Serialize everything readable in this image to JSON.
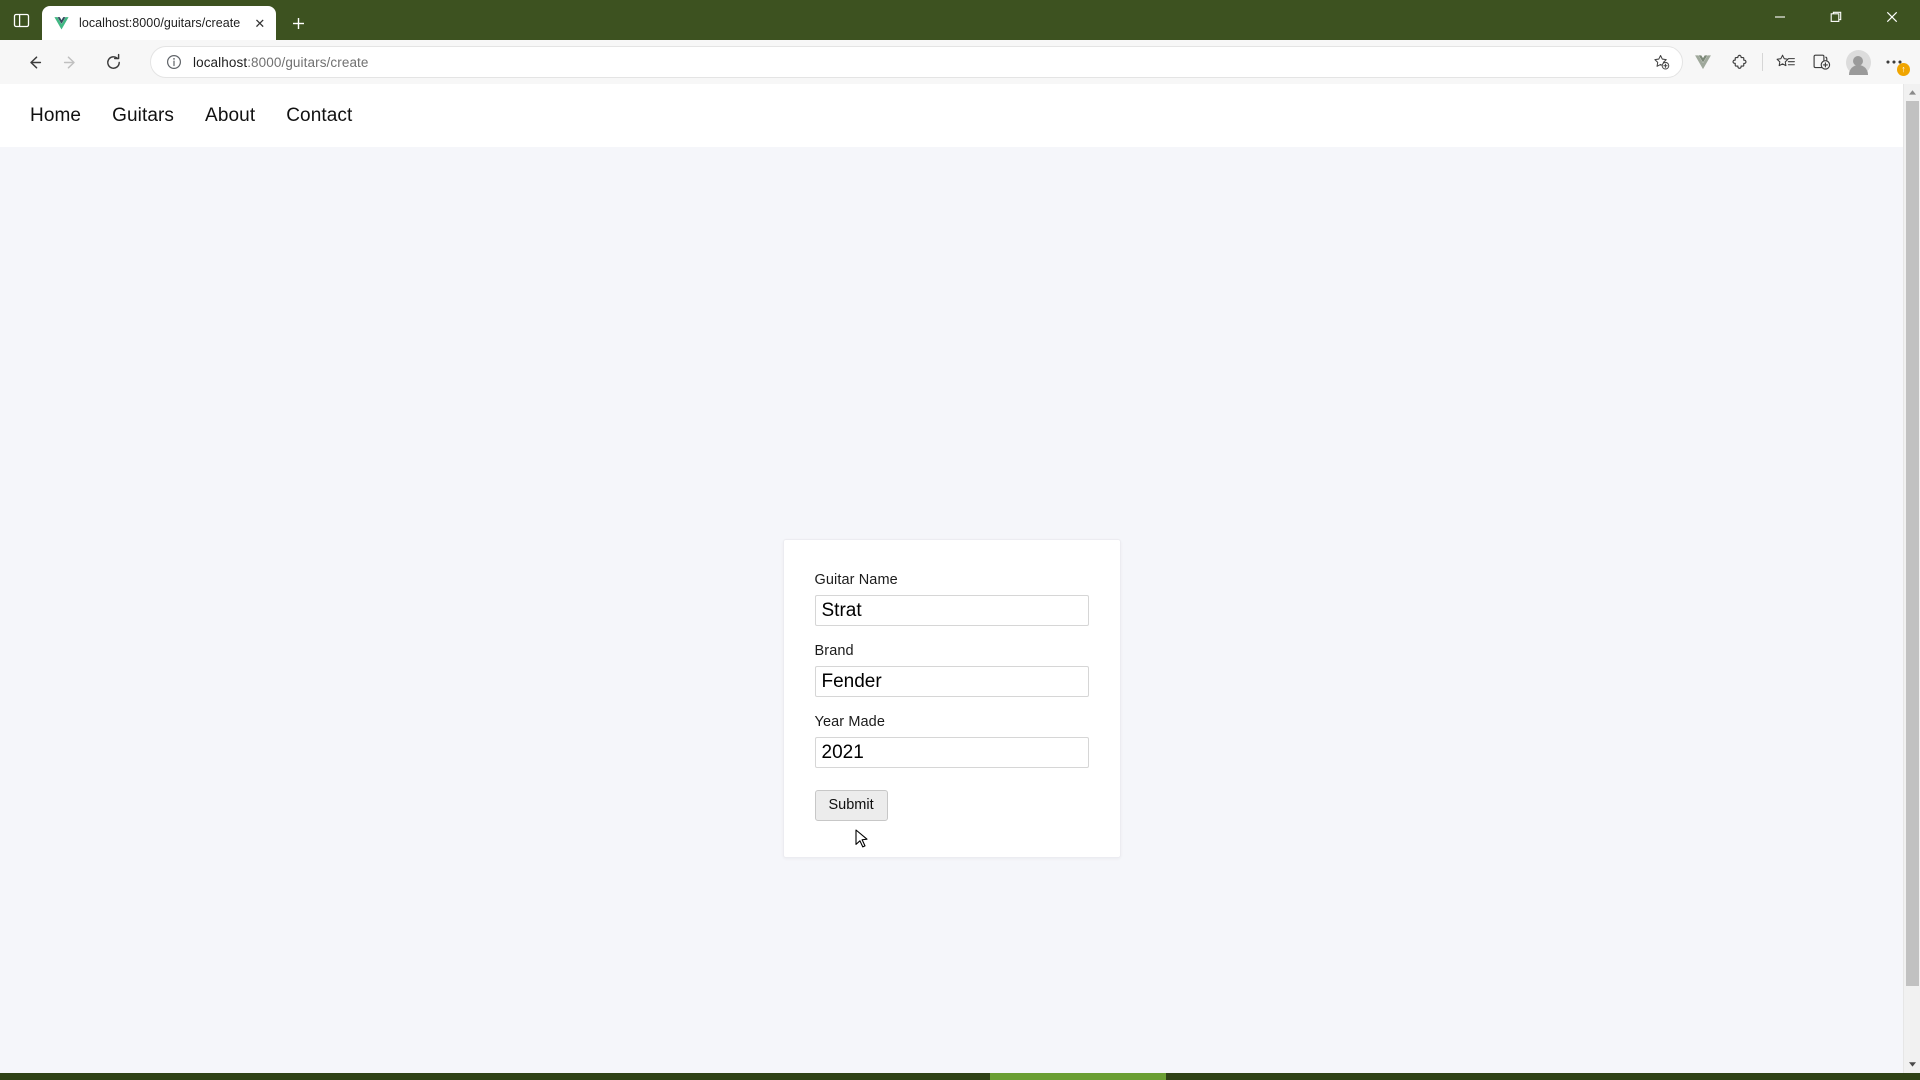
{
  "browser": {
    "tab_manager_icon": "split-pane-icon",
    "tab": {
      "favicon": "vue-logo-icon",
      "title": "localhost:8000/guitars/create",
      "close_label": "✕"
    },
    "new_tab_label": "+",
    "window_controls": {
      "minimize": "—",
      "maximize": "❐",
      "close": "✕"
    },
    "toolbar": {
      "back_label": "←",
      "forward_label": "→",
      "reload_label": "↻",
      "site_info_icon": "info-circle-icon",
      "url_host": "localhost",
      "url_path": ":8000/guitars/create",
      "url_full": "localhost:8000/guitars/create",
      "add_favorite_icon": "star-add-icon",
      "vue_devtools_icon": "vue-devtools-icon",
      "extensions_icon": "extensions-puzzle-icon",
      "favorites_icon": "favorites-star-list-icon",
      "collections_icon": "collections-add-icon",
      "profile_icon": "profile-avatar-icon",
      "settings_icon": "settings-ellipsis-icon",
      "update_badge": "↑"
    },
    "scrollbar": {
      "up_arrow": "▲",
      "down_arrow": "▼"
    }
  },
  "page": {
    "nav": {
      "items": [
        {
          "label": "Home"
        },
        {
          "label": "Guitars"
        },
        {
          "label": "About"
        },
        {
          "label": "Contact"
        }
      ]
    },
    "form": {
      "fields": [
        {
          "label": "Guitar Name",
          "value": "Strat",
          "placeholder": ""
        },
        {
          "label": "Brand",
          "value": "Fender",
          "placeholder": ""
        },
        {
          "label": "Year Made",
          "value": "2021",
          "placeholder": ""
        }
      ],
      "submit_label": "Submit"
    }
  },
  "colors": {
    "browser_chrome": "#3d5220",
    "page_bg": "#f5f6fa",
    "card_bg": "#ffffff",
    "taskbar": "#2f4116",
    "taskbar_active": "#6a9e33",
    "update_badge": "#f0a500"
  }
}
